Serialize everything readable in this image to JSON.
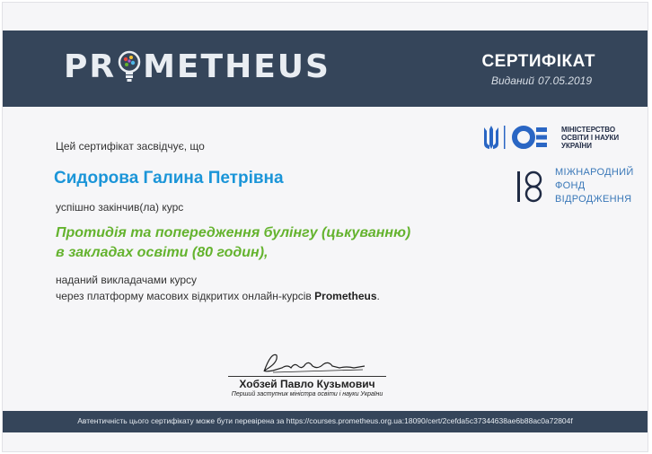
{
  "header": {
    "logo_left": "PR",
    "logo_right": "METHEUS",
    "title": "СЕРТИФІКАТ",
    "issued_label": "Виданий",
    "issued_date": "07.05.2019"
  },
  "partners": {
    "ministry": [
      "МІНІСТЕРСТВО",
      "ОСВІТИ І НАУКИ",
      "УКРАЇНИ"
    ],
    "fund": [
      "МІЖНАРОДНИЙ",
      "ФОНД",
      "ВІДРОДЖЕННЯ"
    ]
  },
  "body": {
    "intro": "Цей сертифікат засвідчує, що",
    "recipient": "Сидорова Галина Петрівна",
    "completed": "успішно закінчив(ла) курс",
    "course_line1": "Протидія та попередження булінгу (цькуванню)",
    "course_line2": "в закладах освіти (80 годин),",
    "provided_line1": "наданий викладачами курсу",
    "provided_line2": "через платформу масових відкритих онлайн-курсів",
    "platform": "Prometheus",
    "period": "."
  },
  "signature": {
    "name": "Хобзей Павло Кузьмович",
    "role": "Перший заступник міністра освіти і науки України"
  },
  "footer": {
    "verification": "Автентичність цього сертифікату може бути перевірена за https://courses.prometheus.org.ua:18090/cert/2cefda5c37344638ae6b88ac0a72804f"
  },
  "colors": {
    "header_bg": "#35455a",
    "recipient": "#1b95d8",
    "course": "#64b32e"
  }
}
